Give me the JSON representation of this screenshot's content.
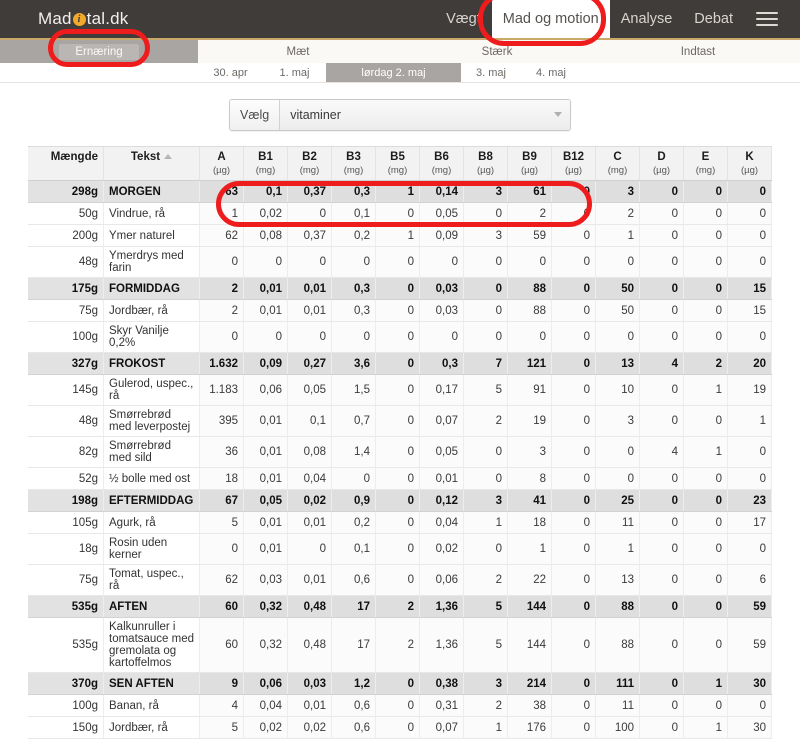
{
  "header": {
    "logo_pre": "Mad",
    "logo_dot": "i",
    "logo_post": "tal.dk",
    "nav": [
      {
        "label": "Vægt",
        "active": false
      },
      {
        "label": "Mad og motion",
        "active": true
      },
      {
        "label": "Analyse",
        "active": false
      },
      {
        "label": "Debat",
        "active": false
      }
    ],
    "menu_icon": "hamburger-menu-icon"
  },
  "subnav": [
    {
      "label": "Ernæring",
      "active": true
    },
    {
      "label": "Mæt",
      "active": false
    },
    {
      "label": "Stærk",
      "active": false
    },
    {
      "label": "Indtast",
      "active": false
    }
  ],
  "dates": [
    {
      "label": "30. apr",
      "selected": false
    },
    {
      "label": "1. maj",
      "selected": false
    },
    {
      "label": "lørdag 2. maj",
      "selected": true
    },
    {
      "label": "3. maj",
      "selected": false
    },
    {
      "label": "4. maj",
      "selected": false
    }
  ],
  "selector": {
    "label": "Vælg",
    "value": "vitaminer",
    "caret": "chevron-down-icon"
  },
  "table": {
    "headers": {
      "amount": "Mængde",
      "text": "Tekst",
      "sort_indicator": "▲",
      "nutrients": [
        {
          "name": "A",
          "unit": "(µg)"
        },
        {
          "name": "B1",
          "unit": "(mg)"
        },
        {
          "name": "B2",
          "unit": "(mg)"
        },
        {
          "name": "B3",
          "unit": "(mg)"
        },
        {
          "name": "B5",
          "unit": "(mg)"
        },
        {
          "name": "B6",
          "unit": "(mg)"
        },
        {
          "name": "B8",
          "unit": "(µg)"
        },
        {
          "name": "B9",
          "unit": "(µg)"
        },
        {
          "name": "B12",
          "unit": "(µg)"
        },
        {
          "name": "C",
          "unit": "(mg)"
        },
        {
          "name": "D",
          "unit": "(µg)"
        },
        {
          "name": "E",
          "unit": "(mg)"
        },
        {
          "name": "K",
          "unit": "(µg)"
        }
      ]
    },
    "rows": [
      {
        "type": "meal",
        "amount": "298g",
        "text": "MORGEN",
        "values": [
          "63",
          "0,1",
          "0,37",
          "0,3",
          "1",
          "0,14",
          "3",
          "61",
          "0",
          "3",
          "0",
          "0",
          "0"
        ]
      },
      {
        "type": "item",
        "amount": "50g",
        "text": "Vindrue, rå",
        "values": [
          "1",
          "0,02",
          "0",
          "0,1",
          "0",
          "0,05",
          "0",
          "2",
          "0",
          "2",
          "0",
          "0",
          "0"
        ]
      },
      {
        "type": "item",
        "amount": "200g",
        "text": "Ymer naturel",
        "values": [
          "62",
          "0,08",
          "0,37",
          "0,2",
          "1",
          "0,09",
          "3",
          "59",
          "0",
          "1",
          "0",
          "0",
          "0"
        ]
      },
      {
        "type": "item",
        "amount": "48g",
        "text": "Ymerdrys med farin",
        "values": [
          "0",
          "0",
          "0",
          "0",
          "0",
          "0",
          "0",
          "0",
          "0",
          "0",
          "0",
          "0",
          "0"
        ]
      },
      {
        "type": "meal",
        "amount": "175g",
        "text": "FORMIDDAG",
        "values": [
          "2",
          "0,01",
          "0,01",
          "0,3",
          "0",
          "0,03",
          "0",
          "88",
          "0",
          "50",
          "0",
          "0",
          "15"
        ]
      },
      {
        "type": "item",
        "amount": "75g",
        "text": "Jordbær, rå",
        "values": [
          "2",
          "0,01",
          "0,01",
          "0,3",
          "0",
          "0,03",
          "0",
          "88",
          "0",
          "50",
          "0",
          "0",
          "15"
        ]
      },
      {
        "type": "item",
        "amount": "100g",
        "text": "Skyr Vanilje 0,2%",
        "values": [
          "0",
          "0",
          "0",
          "0",
          "0",
          "0",
          "0",
          "0",
          "0",
          "0",
          "0",
          "0",
          "0"
        ]
      },
      {
        "type": "meal",
        "amount": "327g",
        "text": "FROKOST",
        "values": [
          "1.632",
          "0,09",
          "0,27",
          "3,6",
          "0",
          "0,3",
          "7",
          "121",
          "0",
          "13",
          "4",
          "2",
          "20"
        ]
      },
      {
        "type": "item",
        "amount": "145g",
        "text": "Gulerod, uspec., rå",
        "values": [
          "1.183",
          "0,06",
          "0,05",
          "1,5",
          "0",
          "0,17",
          "5",
          "91",
          "0",
          "10",
          "0",
          "1",
          "19"
        ]
      },
      {
        "type": "item",
        "amount": "48g",
        "text": "Smørrebrød med leverpostej",
        "values": [
          "395",
          "0,01",
          "0,1",
          "0,7",
          "0",
          "0,07",
          "2",
          "19",
          "0",
          "3",
          "0",
          "0",
          "1"
        ]
      },
      {
        "type": "item",
        "amount": "82g",
        "text": "Smørrebrød med sild",
        "values": [
          "36",
          "0,01",
          "0,08",
          "1,4",
          "0",
          "0,05",
          "0",
          "3",
          "0",
          "0",
          "4",
          "1",
          "0"
        ]
      },
      {
        "type": "item",
        "amount": "52g",
        "text": "½ bolle med ost",
        "values": [
          "18",
          "0,01",
          "0,04",
          "0",
          "0",
          "0,01",
          "0",
          "8",
          "0",
          "0",
          "0",
          "0",
          "0"
        ]
      },
      {
        "type": "meal",
        "amount": "198g",
        "text": "EFTERMIDDAG",
        "values": [
          "67",
          "0,05",
          "0,02",
          "0,9",
          "0",
          "0,12",
          "3",
          "41",
          "0",
          "25",
          "0",
          "0",
          "23"
        ]
      },
      {
        "type": "item",
        "amount": "105g",
        "text": "Agurk, rå",
        "values": [
          "5",
          "0,01",
          "0,01",
          "0,2",
          "0",
          "0,04",
          "1",
          "18",
          "0",
          "11",
          "0",
          "0",
          "17"
        ]
      },
      {
        "type": "item",
        "amount": "18g",
        "text": "Rosin uden kerner",
        "values": [
          "0",
          "0,01",
          "0",
          "0,1",
          "0",
          "0,02",
          "0",
          "1",
          "0",
          "1",
          "0",
          "0",
          "0"
        ]
      },
      {
        "type": "item",
        "amount": "75g",
        "text": "Tomat, uspec., rå",
        "values": [
          "62",
          "0,03",
          "0,01",
          "0,6",
          "0",
          "0,06",
          "2",
          "22",
          "0",
          "13",
          "0",
          "0",
          "6"
        ]
      },
      {
        "type": "meal",
        "amount": "535g",
        "text": "AFTEN",
        "values": [
          "60",
          "0,32",
          "0,48",
          "17",
          "2",
          "1,36",
          "5",
          "144",
          "0",
          "88",
          "0",
          "0",
          "59"
        ]
      },
      {
        "type": "item",
        "amount": "535g",
        "text": "Kalkunruller i tomatsauce med gremolata og kartoffelmos",
        "values": [
          "60",
          "0,32",
          "0,48",
          "17",
          "2",
          "1,36",
          "5",
          "144",
          "0",
          "88",
          "0",
          "0",
          "59"
        ]
      },
      {
        "type": "meal",
        "amount": "370g",
        "text": "SEN AFTEN",
        "values": [
          "9",
          "0,06",
          "0,03",
          "1,2",
          "0",
          "0,38",
          "3",
          "214",
          "0",
          "111",
          "0",
          "1",
          "30"
        ]
      },
      {
        "type": "item",
        "amount": "100g",
        "text": "Banan, rå",
        "values": [
          "4",
          "0,04",
          "0,01",
          "0,6",
          "0",
          "0,31",
          "2",
          "38",
          "0",
          "11",
          "0",
          "0",
          "0"
        ]
      },
      {
        "type": "item",
        "amount": "150g",
        "text": "Jordbær, rå",
        "values": [
          "5",
          "0,02",
          "0,02",
          "0,6",
          "0",
          "0,07",
          "1",
          "176",
          "0",
          "100",
          "0",
          "1",
          "30"
        ]
      }
    ]
  },
  "annotations": {
    "color": "#ee1c1c",
    "marks": [
      "highlight-mad-og-motion",
      "highlight-ernaering",
      "highlight-selector"
    ]
  }
}
